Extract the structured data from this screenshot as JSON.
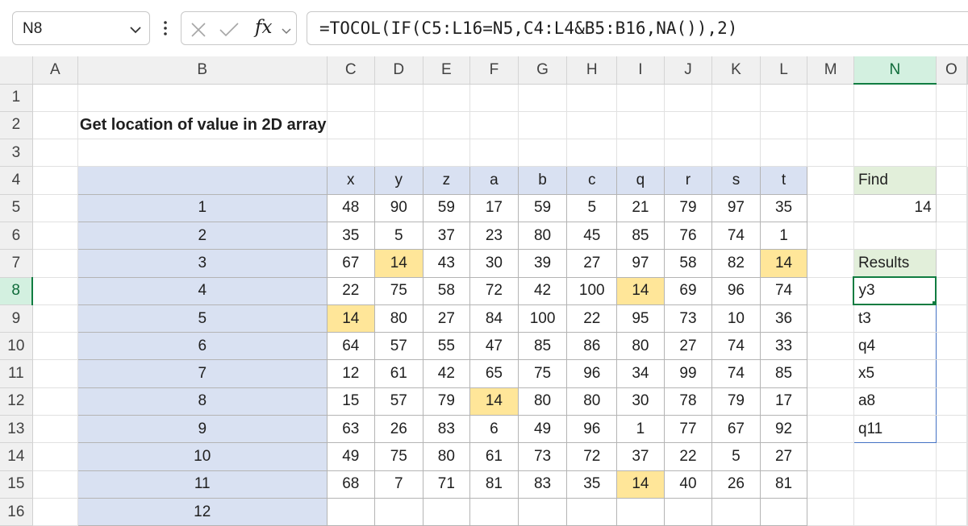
{
  "formula_bar": {
    "name_box": "N8",
    "fx_label": "fx",
    "formula": "=TOCOL(IF(C5:L16=N5,C4:L4&B5:B16,NA()),2)"
  },
  "sheet": {
    "columns": [
      "A",
      "B",
      "C",
      "D",
      "E",
      "F",
      "G",
      "H",
      "I",
      "J",
      "K",
      "L",
      "M",
      "N",
      "O"
    ],
    "selected_column": "N",
    "rows": [
      "1",
      "2",
      "3",
      "4",
      "5",
      "6",
      "7",
      "8",
      "9",
      "10",
      "11",
      "12",
      "13",
      "14",
      "15",
      "16"
    ],
    "selected_row": "8",
    "title": "Get location of value in 2D array"
  },
  "table": {
    "col_headers": [
      "x",
      "y",
      "z",
      "a",
      "b",
      "c",
      "q",
      "r",
      "s",
      "t"
    ],
    "row_labels": [
      "1",
      "2",
      "3",
      "4",
      "5",
      "6",
      "7",
      "8",
      "9",
      "10",
      "11",
      "12"
    ],
    "values": [
      [
        "48",
        "90",
        "59",
        "17",
        "59",
        "5",
        "21",
        "79",
        "97",
        "35"
      ],
      [
        "35",
        "5",
        "37",
        "23",
        "80",
        "45",
        "85",
        "76",
        "74",
        "1"
      ],
      [
        "67",
        "14",
        "43",
        "30",
        "39",
        "27",
        "97",
        "58",
        "82",
        "14"
      ],
      [
        "22",
        "75",
        "58",
        "72",
        "42",
        "100",
        "14",
        "69",
        "96",
        "74"
      ],
      [
        "14",
        "80",
        "27",
        "84",
        "100",
        "22",
        "95",
        "73",
        "10",
        "36"
      ],
      [
        "64",
        "57",
        "55",
        "47",
        "85",
        "86",
        "80",
        "27",
        "74",
        "33"
      ],
      [
        "12",
        "61",
        "42",
        "65",
        "75",
        "96",
        "34",
        "99",
        "74",
        "85"
      ],
      [
        "15",
        "57",
        "79",
        "14",
        "80",
        "80",
        "30",
        "78",
        "79",
        "17"
      ],
      [
        "63",
        "26",
        "83",
        "6",
        "49",
        "96",
        "1",
        "77",
        "67",
        "92"
      ],
      [
        "49",
        "75",
        "80",
        "61",
        "73",
        "72",
        "37",
        "22",
        "5",
        "27"
      ],
      [
        "68",
        "7",
        "71",
        "81",
        "83",
        "35",
        "14",
        "40",
        "26",
        "81"
      ],
      [
        "",
        "",
        "",
        "",
        "",
        "",
        "",
        "",
        "",
        ""
      ]
    ],
    "highlight_color": "#ffe699",
    "header_fill": "#d9e1f2"
  },
  "find": {
    "label": "Find",
    "value": "14"
  },
  "results": {
    "label": "Results",
    "items": [
      "y3",
      "t3",
      "q4",
      "x5",
      "a8",
      "q11"
    ]
  },
  "colors": {
    "accent": "#107c41",
    "label_fill": "#e2efda",
    "spill_border": "#4472c4"
  },
  "icons": {
    "namebox_dropdown": "chevron-down-icon",
    "more": "vertical-dots-icon",
    "cancel": "close-icon",
    "enter": "checkmark-icon",
    "formula_dropdown": "chevron-down-icon"
  }
}
